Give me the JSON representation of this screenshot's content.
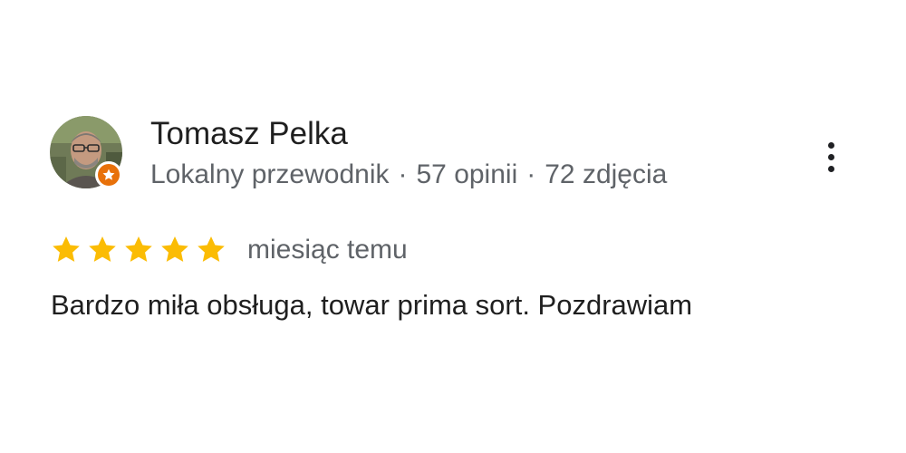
{
  "review": {
    "reviewer": {
      "name": "Tomasz Pelka",
      "role": "Lokalny przewodnik",
      "reviews_count": "57 opinii",
      "photos_count": "72 zdjęcia",
      "separator": "·",
      "avatar_icon": "person-photo-avatar",
      "badge_icon": "local-guide-star-icon"
    },
    "rating": 5,
    "max_rating": 5,
    "time": "miesiąc temu",
    "text": "Bardzo miła obsługa, towar prima sort. Pozdrawiam",
    "menu_icon": "more-vert-icon"
  },
  "colors": {
    "star": "#FBBC04",
    "badge": "#E8710A",
    "name": "#1f1f1f",
    "meta": "#5f6368",
    "menu": "#202124"
  }
}
